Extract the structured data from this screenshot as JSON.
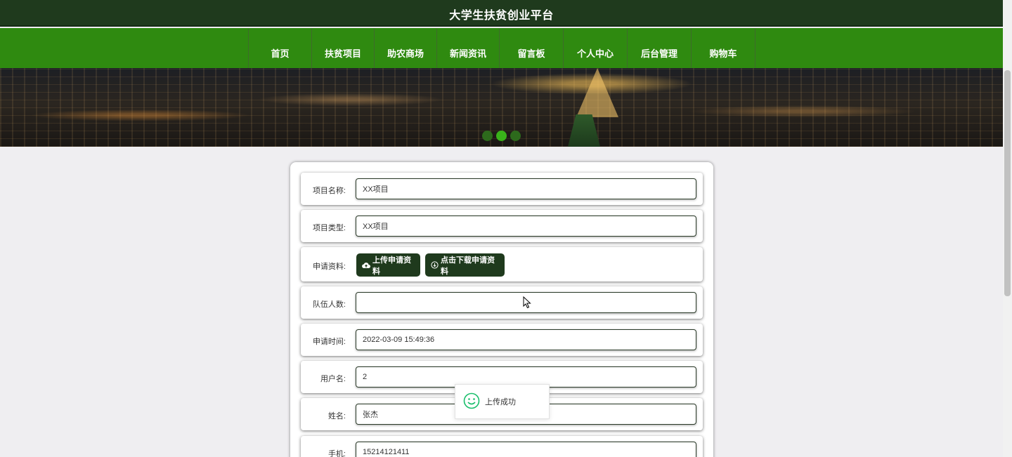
{
  "site_title": "大学生扶贫创业平台",
  "nav": {
    "items": [
      {
        "label": "首页",
        "w": 90
      },
      {
        "label": "扶贫项目",
        "w": 89
      },
      {
        "label": "助农商场",
        "w": 89
      },
      {
        "label": "新闻资讯",
        "w": 89
      },
      {
        "label": "留言板",
        "w": 91
      },
      {
        "label": "个人中心",
        "w": 91
      },
      {
        "label": "后台管理",
        "w": 91
      },
      {
        "label": "购物车",
        "w": 91
      }
    ]
  },
  "carousel": {
    "slide_count": 3,
    "active_index": 1
  },
  "form": {
    "project_name": {
      "label": "项目名称:",
      "value": "XX项目"
    },
    "project_type": {
      "label": "项目类型:",
      "value": "XX项目"
    },
    "application_materials": {
      "label": "申请资料:",
      "upload_label": "上传申请资料",
      "download_label": "点击下载申请资料"
    },
    "team_size": {
      "label": "队伍人数:",
      "value": ""
    },
    "apply_time": {
      "label": "申请时间:",
      "value": "2022-03-09 15:49:36"
    },
    "username": {
      "label": "用户名:",
      "value": "2"
    },
    "name": {
      "label": "姓名:",
      "value": "张杰"
    },
    "phone": {
      "label": "手机:",
      "value": "15214121411"
    }
  },
  "toast": {
    "message": "上传成功",
    "icon": "smile-icon",
    "color": "#19be6b"
  },
  "colors": {
    "header": "#1f3a1d",
    "nav": "#2f8a10",
    "button": "#1f3a1d",
    "page_bg": "#efeef1"
  }
}
